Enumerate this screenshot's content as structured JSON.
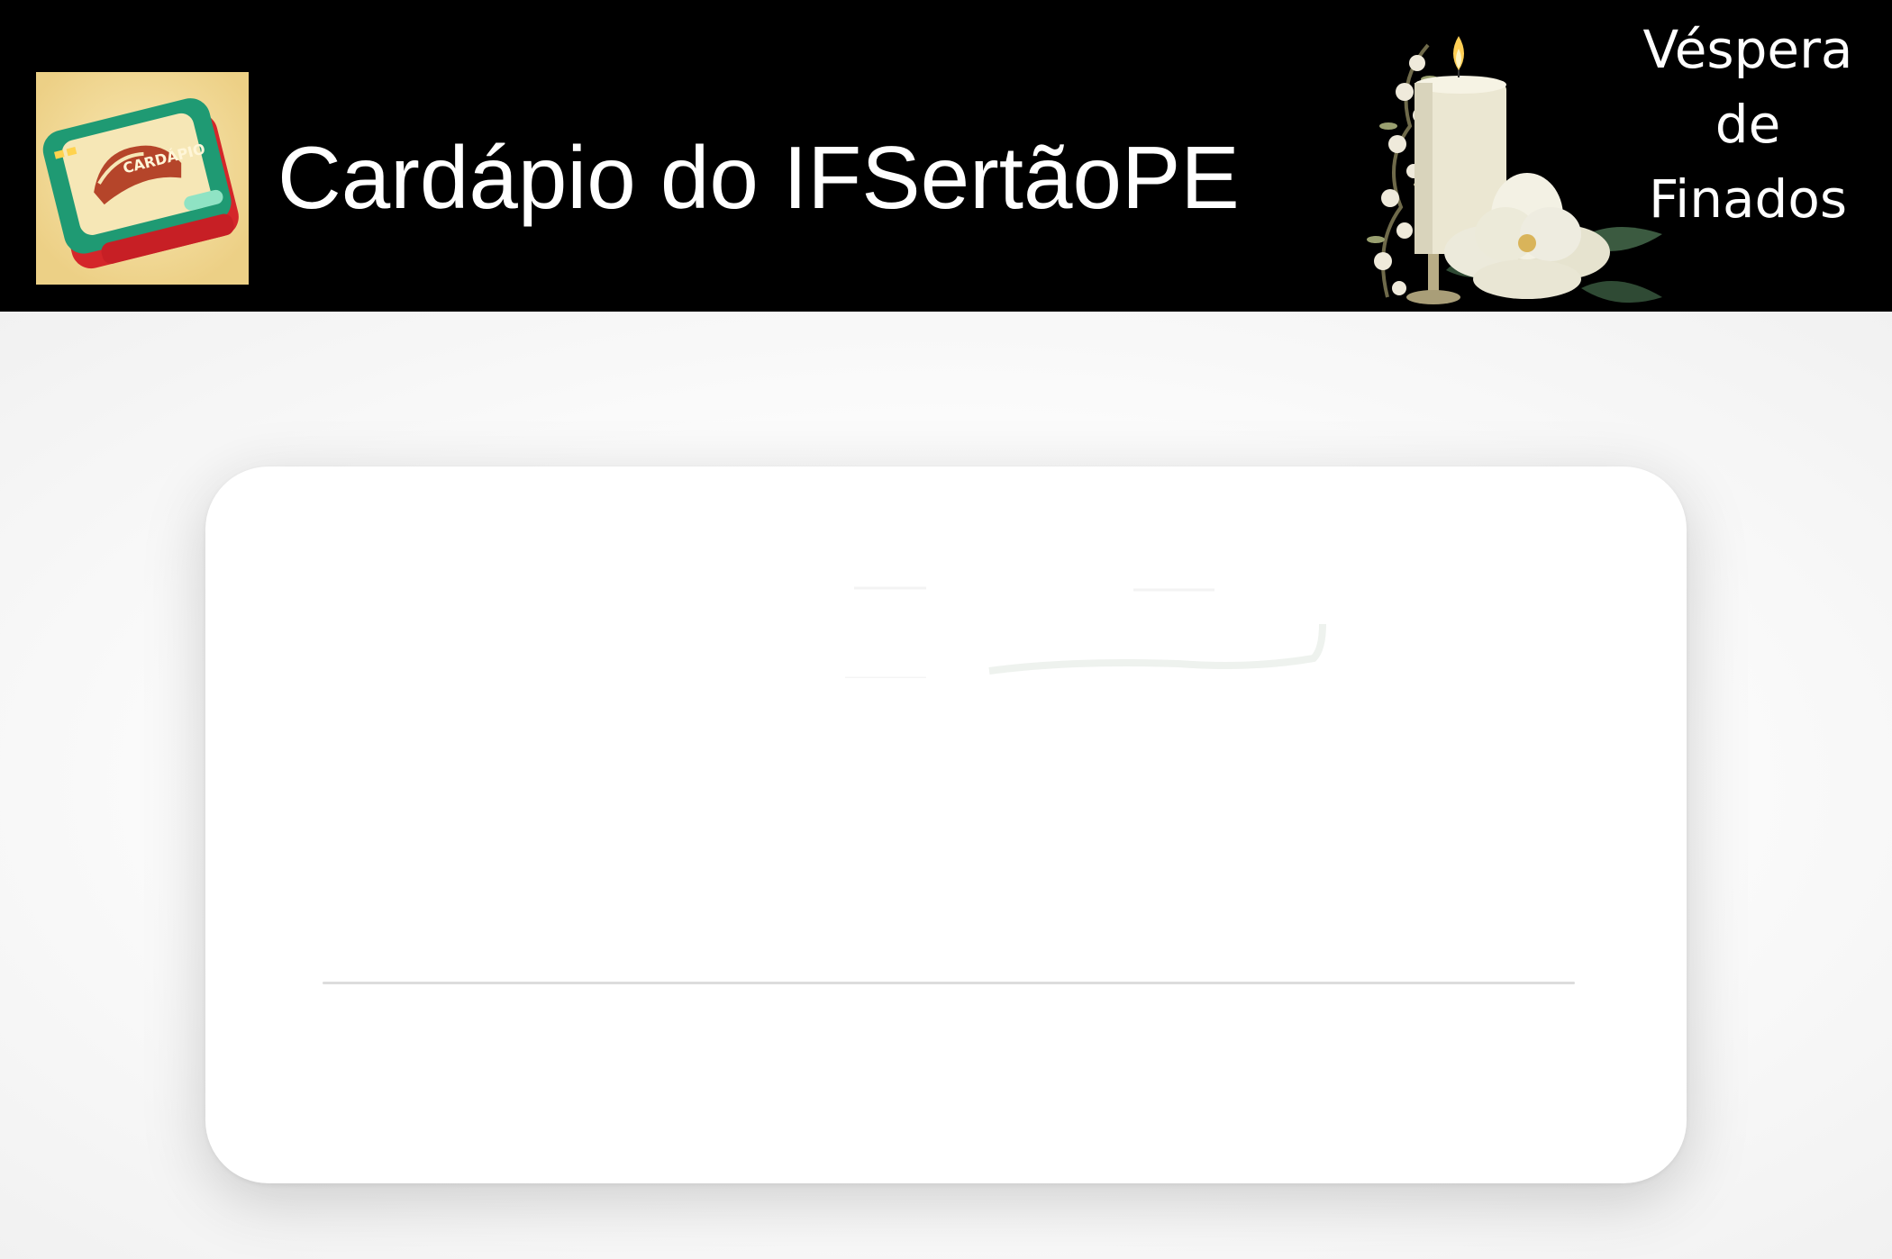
{
  "header": {
    "title": "Cardápio do IFSertãoPE",
    "logo_icon": "menu-book-logo-icon",
    "logo_text": "CARDÁPIO",
    "event_icon": "candle-flower-icon",
    "event_lines": [
      "Véspera",
      "de",
      "Finados"
    ],
    "background": "#000000"
  },
  "card": {
    "state": "loading",
    "background": "#ffffff"
  }
}
